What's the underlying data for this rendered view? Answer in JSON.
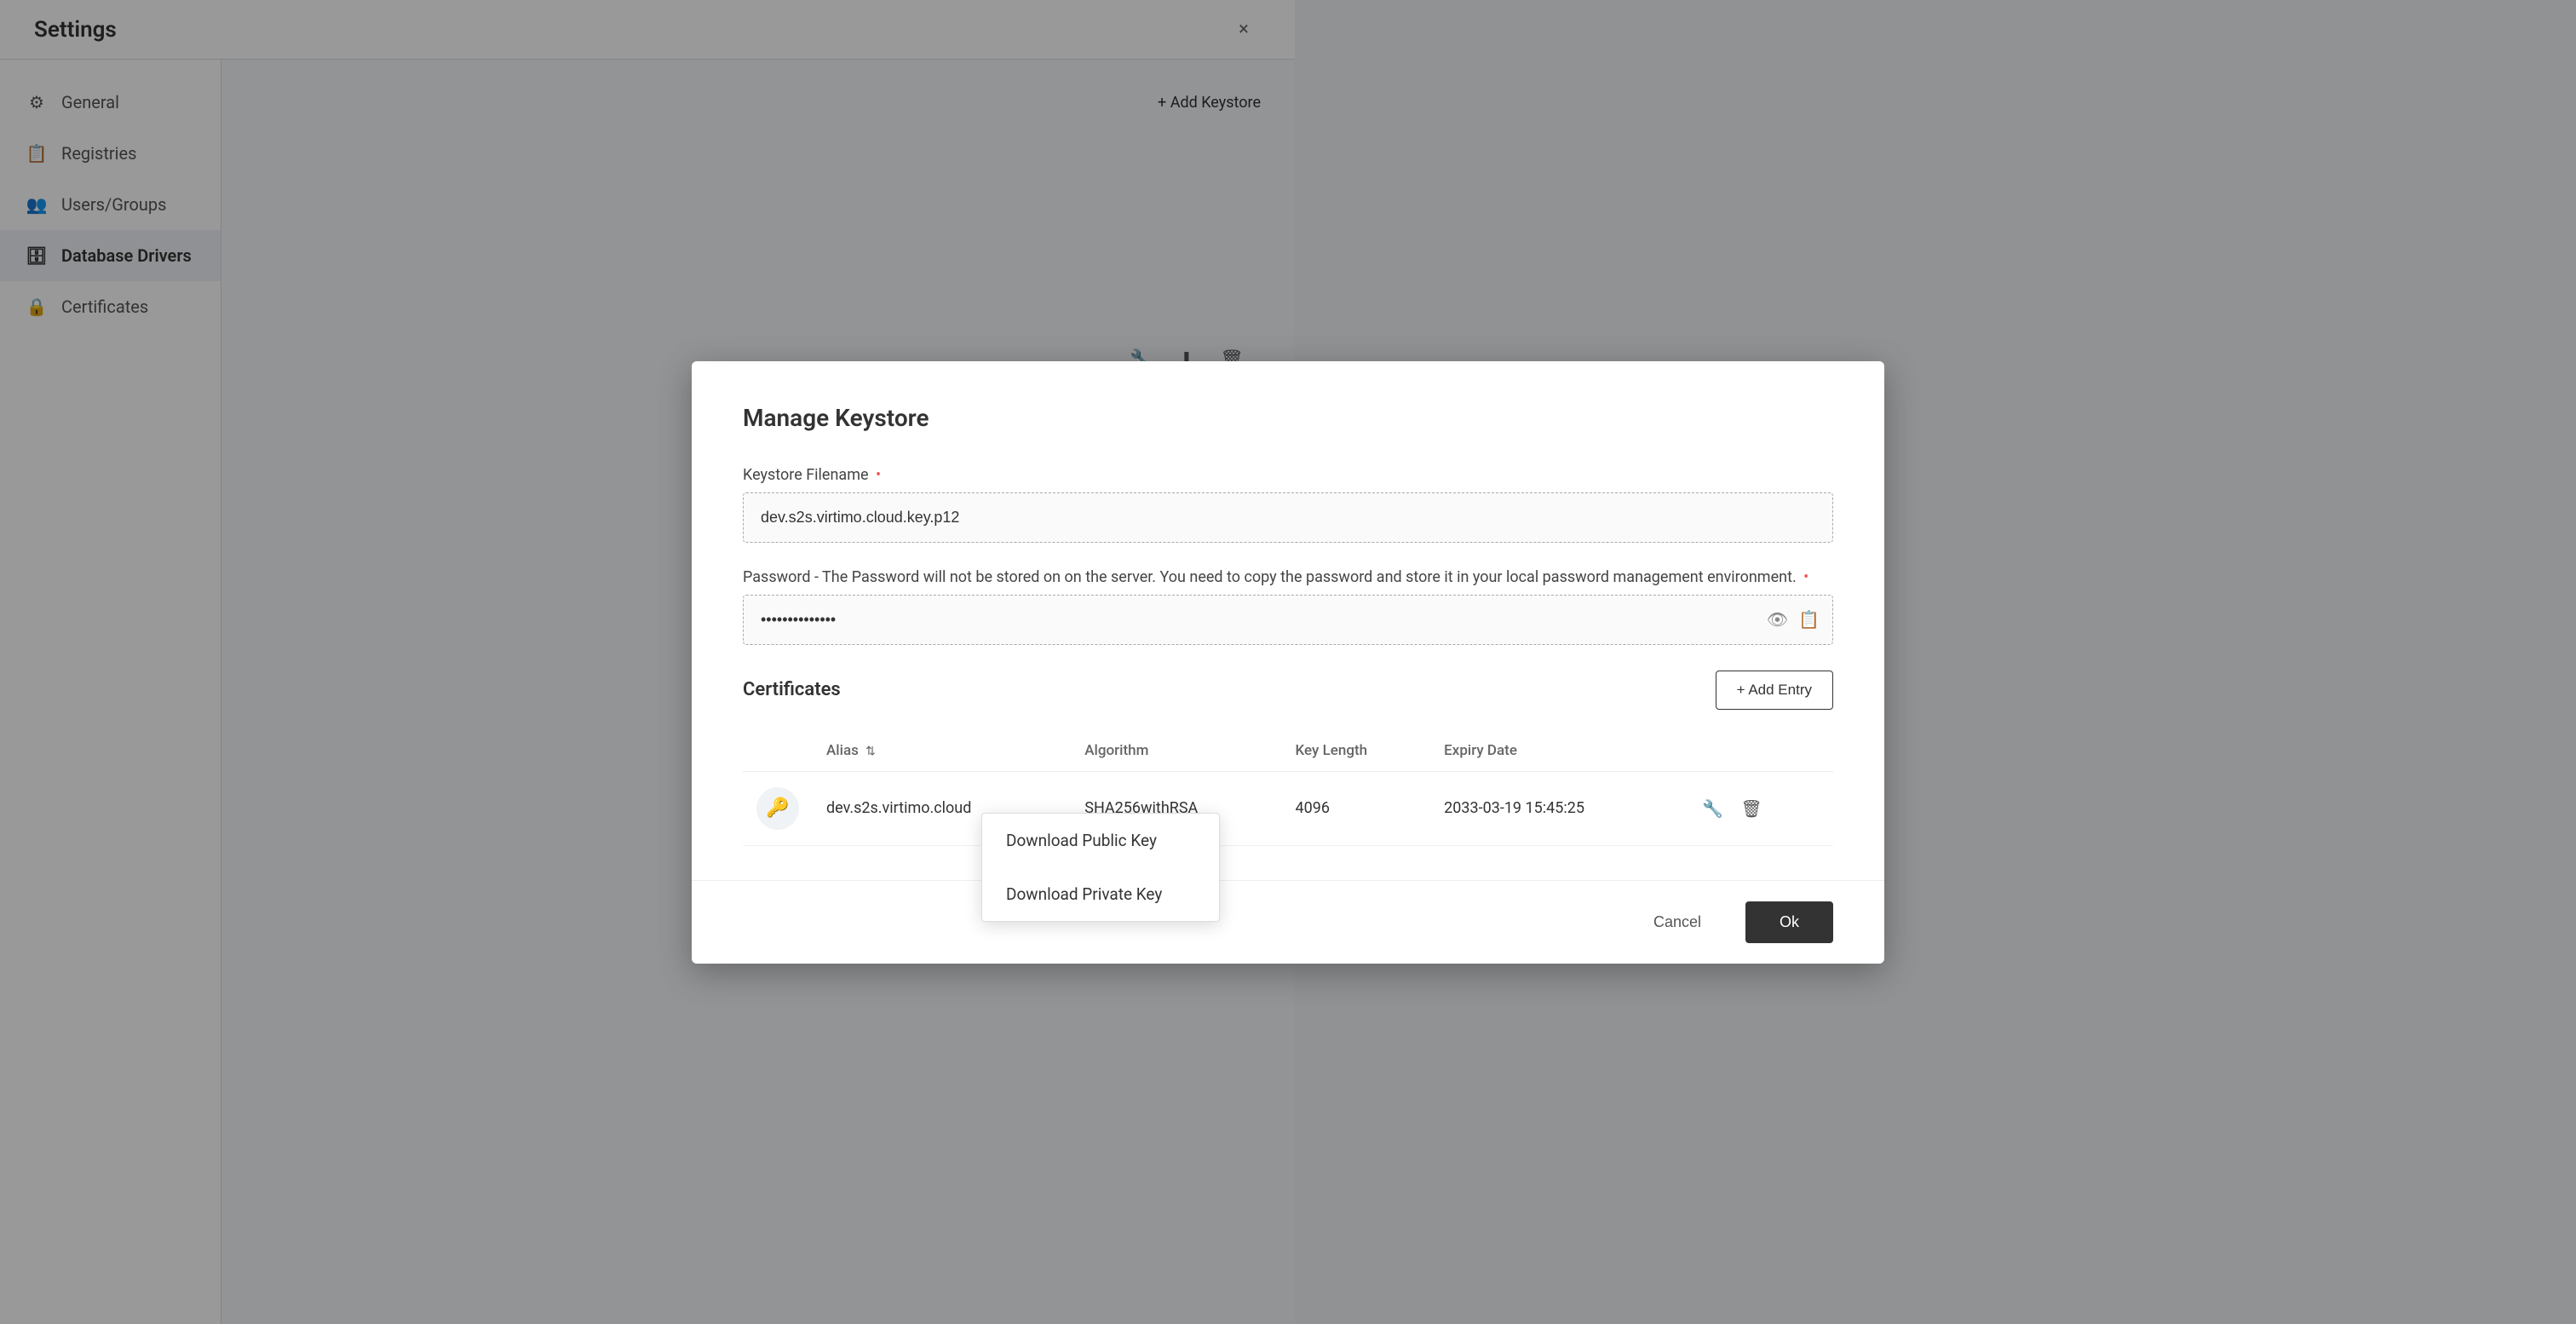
{
  "settings": {
    "title": "Settings",
    "close_label": "×"
  },
  "sidebar": {
    "items": [
      {
        "id": "general",
        "label": "General",
        "icon": "⚙"
      },
      {
        "id": "registries",
        "label": "Registries",
        "icon": "📋"
      },
      {
        "id": "users-groups",
        "label": "Users/Groups",
        "icon": "👥"
      },
      {
        "id": "database-drivers",
        "label": "Database Drivers",
        "icon": "🗄"
      },
      {
        "id": "certificates",
        "label": "Certificates",
        "icon": "🔒"
      }
    ]
  },
  "modal": {
    "title": "Manage Keystore",
    "keystore_filename_label": "Keystore Filename",
    "keystore_filename_required": "•",
    "keystore_filename_value": "dev.s2s.virtimo.cloud.key.p12",
    "password_label": "Password - The Password will not be stored on on the server. You need to copy the password and store it in your local password management environment.",
    "password_required": "•",
    "password_value": "••••••••••••••",
    "certificates_title": "Certificates",
    "add_entry_label": "+ Add Entry",
    "table": {
      "columns": [
        "Alias",
        "Algorithm",
        "Key Length",
        "Expiry Date"
      ],
      "rows": [
        {
          "alias": "dev.s2s.virtimo.cloud",
          "algorithm": "SHA256withRSA",
          "key_length": "4096",
          "expiry_date": "2033-03-19 15:45:25"
        }
      ]
    },
    "dropdown": {
      "items": [
        {
          "id": "download-public-key",
          "label": "Download Public Key"
        },
        {
          "id": "download-private-key",
          "label": "Download Private Key"
        }
      ]
    },
    "cancel_label": "Cancel",
    "ok_label": "Ok"
  },
  "right_panel": {
    "add_keystore_label": "+ Add Keystore"
  },
  "icons": {
    "rows": [
      [
        "wrench",
        "download",
        "trash"
      ],
      [
        "wrench",
        "download",
        "trash"
      ],
      [
        "wrench",
        "download",
        "trash"
      ],
      [
        "wrench",
        "download",
        "trash"
      ],
      [
        "wrench",
        "download",
        "trash"
      ]
    ]
  }
}
